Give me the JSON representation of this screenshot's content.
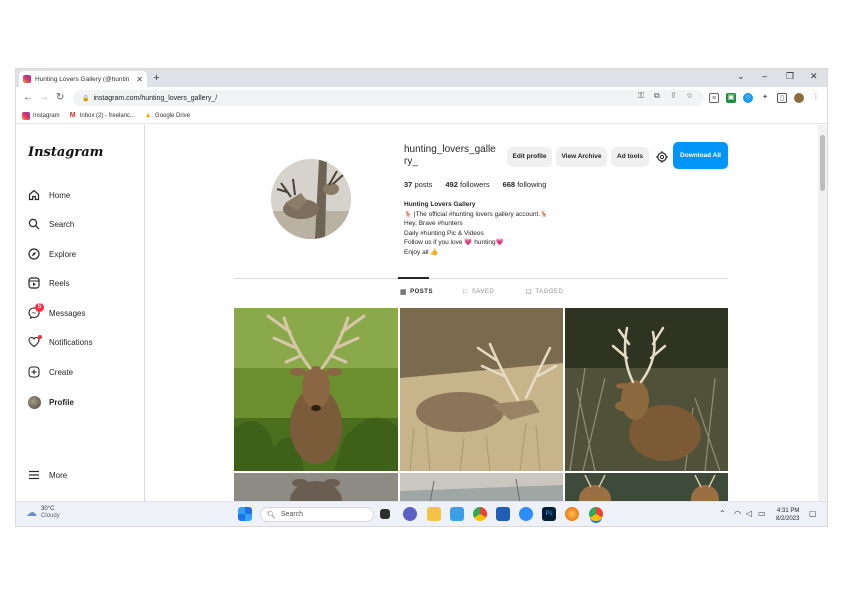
{
  "browser": {
    "tab_title": "Hunting Lovers Gallery (@huntin",
    "url": "instagram.com/hunting_lovers_gallery_/",
    "bookmarks": [
      "Instagram",
      "Inbox (2) - freelanc...",
      "Google Drive"
    ]
  },
  "sidebar": {
    "logo": "Instagram",
    "items": [
      {
        "label": "Home",
        "icon": "home-icon"
      },
      {
        "label": "Search",
        "icon": "search-icon"
      },
      {
        "label": "Explore",
        "icon": "compass-icon"
      },
      {
        "label": "Reels",
        "icon": "reels-icon"
      },
      {
        "label": "Messages",
        "icon": "messenger-icon",
        "badge": "5"
      },
      {
        "label": "Notifications",
        "icon": "heart-icon"
      },
      {
        "label": "Create",
        "icon": "plus-square-icon"
      },
      {
        "label": "Profile",
        "icon": "avatar"
      }
    ],
    "more": "More"
  },
  "profile": {
    "username": "hunting_lovers_gallery_",
    "buttons": {
      "edit": "Edit profile",
      "archive": "View Archive",
      "ad_tools": "Ad tools",
      "download": "Download All"
    },
    "stats": {
      "posts_num": "37",
      "posts_label": "posts",
      "followers_num": "492",
      "followers_label": "followers",
      "following_num": "668",
      "following_label": "following"
    },
    "bio": {
      "name": "Hunting Lovers Gallery",
      "line1": "🦌 |The official #hunting lovers gallery account.🦌",
      "line2": "Hey, Brave #hunters",
      "line3": "Daily #hunting Pic & Videos",
      "line4": "Follow us if you love 💗 hunting💗",
      "line5": "Enjoy all 👍"
    }
  },
  "tabs": {
    "posts": "POSTS",
    "saved": "SAVED",
    "tagged": "TAGGED",
    "active": "posts"
  },
  "taskbar": {
    "temperature": "30°C",
    "condition": "Cloudy",
    "search": "Search",
    "time": "4:31 PM",
    "date": "8/2/2023"
  },
  "colors": {
    "accent": "#0095f6",
    "badge": "#ff3040"
  }
}
